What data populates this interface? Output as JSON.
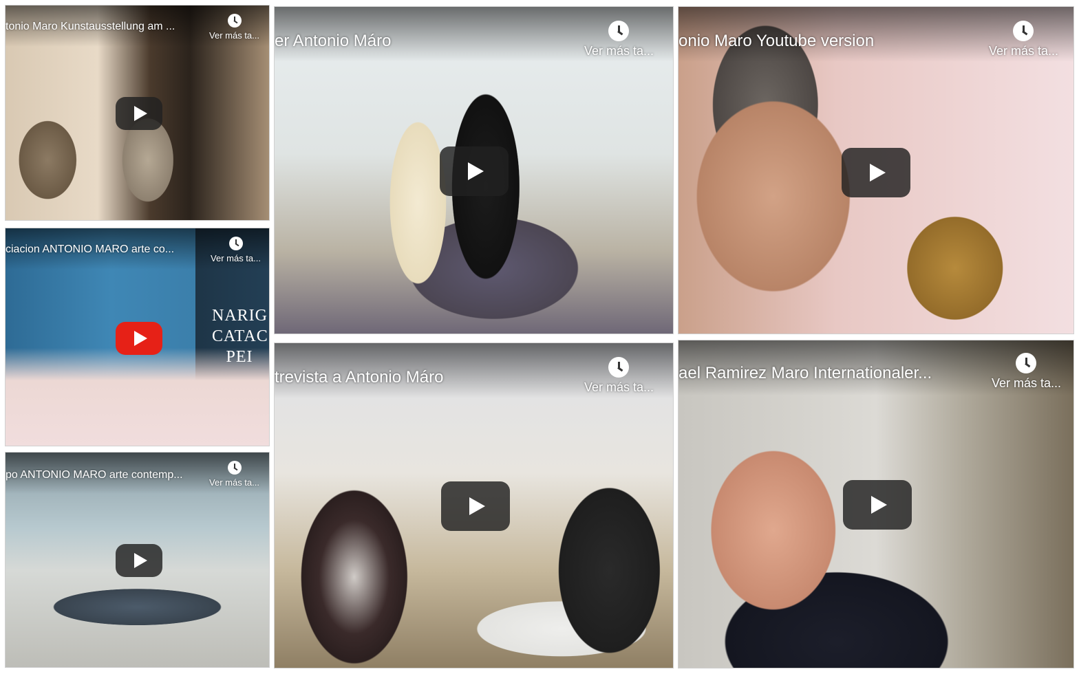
{
  "videos": [
    {
      "title": "tonio Maro Kunstausstellung am ...",
      "watch_later": "Ver más ta..."
    },
    {
      "title": "ciacion ANTONIO MARO arte co...",
      "watch_later": "Ver más ta...",
      "overlay_lines": [
        "NARIG",
        "CATAC",
        "PEI"
      ]
    },
    {
      "title": "po ANTONIO MARO arte contemp...",
      "watch_later": "Ver más ta..."
    },
    {
      "title": "er Antonio Máro",
      "watch_later": "Ver más ta..."
    },
    {
      "title": "trevista a Antonio Máro",
      "watch_later": "Ver más ta..."
    },
    {
      "title": "onio Maro Youtube version",
      "watch_later": "Ver más ta..."
    },
    {
      "title": "ael Ramirez Maro Internationaler...",
      "watch_later": "Ver más ta..."
    }
  ],
  "icons": {
    "play": "play-icon",
    "watch_later": "clock-icon"
  },
  "colors": {
    "play_red": "#e62117",
    "play_dark": "#212121"
  }
}
